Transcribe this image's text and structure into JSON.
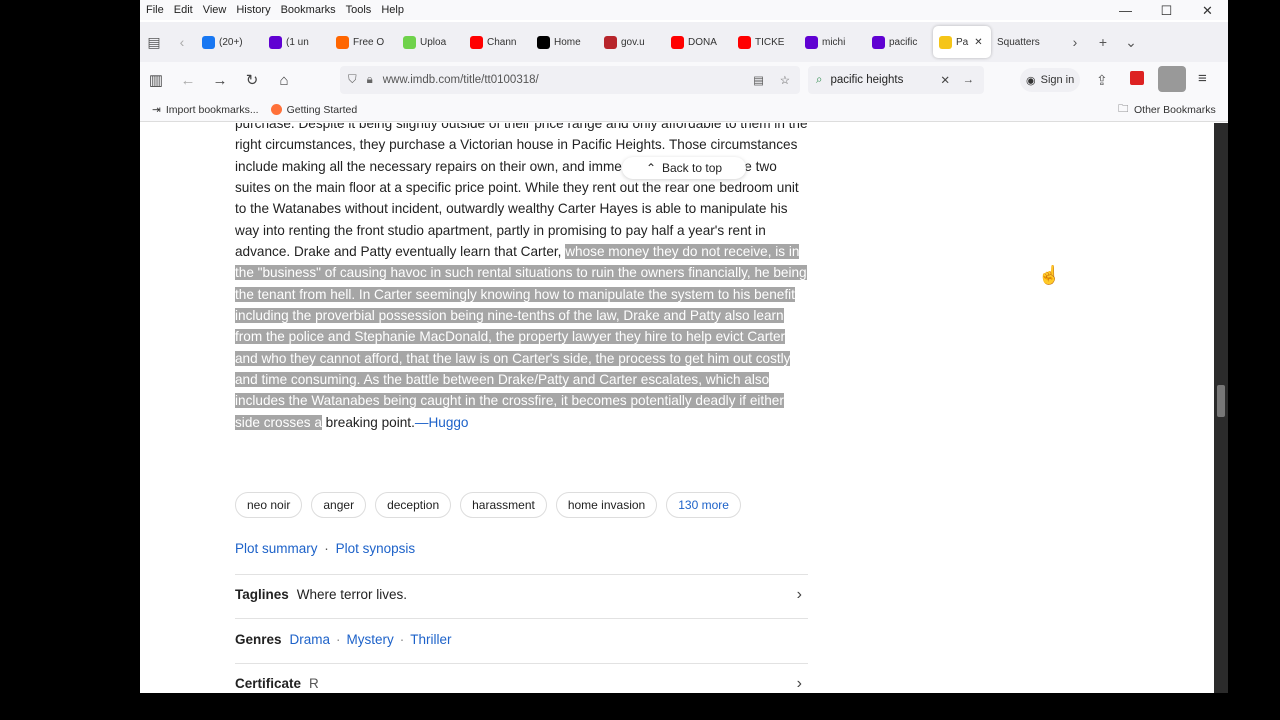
{
  "menubar": {
    "items": [
      "File",
      "Edit",
      "View",
      "History",
      "Bookmarks",
      "Tools",
      "Help"
    ]
  },
  "window_controls": {
    "minimize": "—",
    "maximize": "☐",
    "close": "✕"
  },
  "tabs": [
    {
      "label": "(20+)",
      "color": "#1877f2"
    },
    {
      "label": "(1 un",
      "color": "#6001d2"
    },
    {
      "label": "Free O",
      "color": "#ff6600"
    },
    {
      "label": "Uploa",
      "color": "#6fd24b"
    },
    {
      "label": "Chann",
      "color": "#ff0000"
    },
    {
      "label": "Home",
      "color": "#000000"
    },
    {
      "label": "gov.u",
      "color": "#b7252b"
    },
    {
      "label": "DONA",
      "color": "#ff0000"
    },
    {
      "label": "TICKE",
      "color": "#ff0000"
    },
    {
      "label": "michi",
      "color": "#6001d2"
    },
    {
      "label": "pacific",
      "color": "#6001d2"
    },
    {
      "label": "Pa",
      "color": "#f5c518",
      "active": true
    },
    {
      "label": "Squatters",
      "color": ""
    }
  ],
  "navbar": {
    "url": "www.imdb.com/title/tt0100318/",
    "search_value": "pacific heights",
    "signin": "Sign in"
  },
  "bookmarks": {
    "import": "Import bookmarks...",
    "getting_started": "Getting Started",
    "other": "Other Bookmarks"
  },
  "article": {
    "line0": "purchase. Despite it being slightly outside of their price range and only affordable to",
    "normal": "them in the right circumstances, they purchase a Victorian house in Pacific Heights. Those circumstances include making all the necessary repairs on their own, and immediately renting out the two suites on the main floor at a specific price point. While they rent out the rear one bedroom unit to the Watanabes without incident, outwardly wealthy Carter Hayes is able to manipulate his way into renting the front studio apartment, partly in promising to pay half a year's rent in advance. Drake and Patty eventually learn that Carter, ",
    "highlighted": "whose money they do not receive, is in the \"business\" of causing havoc in such rental situations to ruin the owners financially, he being the tenant from hell. In Carter seemingly knowing how to manipulate the system to his benefit including the proverbial possession being nine-tenths of the law, Drake and Patty also learn from the police and Stephanie MacDonald, the property lawyer they hire to help evict Carter and who they cannot afford, that the law is on Carter's side, the process to get him out costly and time consuming. As the battle between Drake/Patty and Carter escalates, which also includes the Watanabes being caught in the crossfire, it becomes potentially deadly if either side crosses a",
    "tail": " breaking point.",
    "author": "—Huggo"
  },
  "back_to_top": "Back to top",
  "keywords": [
    "neo noir",
    "anger",
    "deception",
    "harassment",
    "home invasion"
  ],
  "more_keywords": "130 more",
  "plot_links": {
    "summary": "Plot summary",
    "dot": "·",
    "synopsis": "Plot synopsis"
  },
  "taglines": {
    "label": "Taglines",
    "value": "Where terror lives."
  },
  "genres": {
    "label": "Genres",
    "items": [
      "Drama",
      "Mystery",
      "Thriller"
    ]
  },
  "certificate": {
    "label": "Certificate",
    "value": "R"
  }
}
